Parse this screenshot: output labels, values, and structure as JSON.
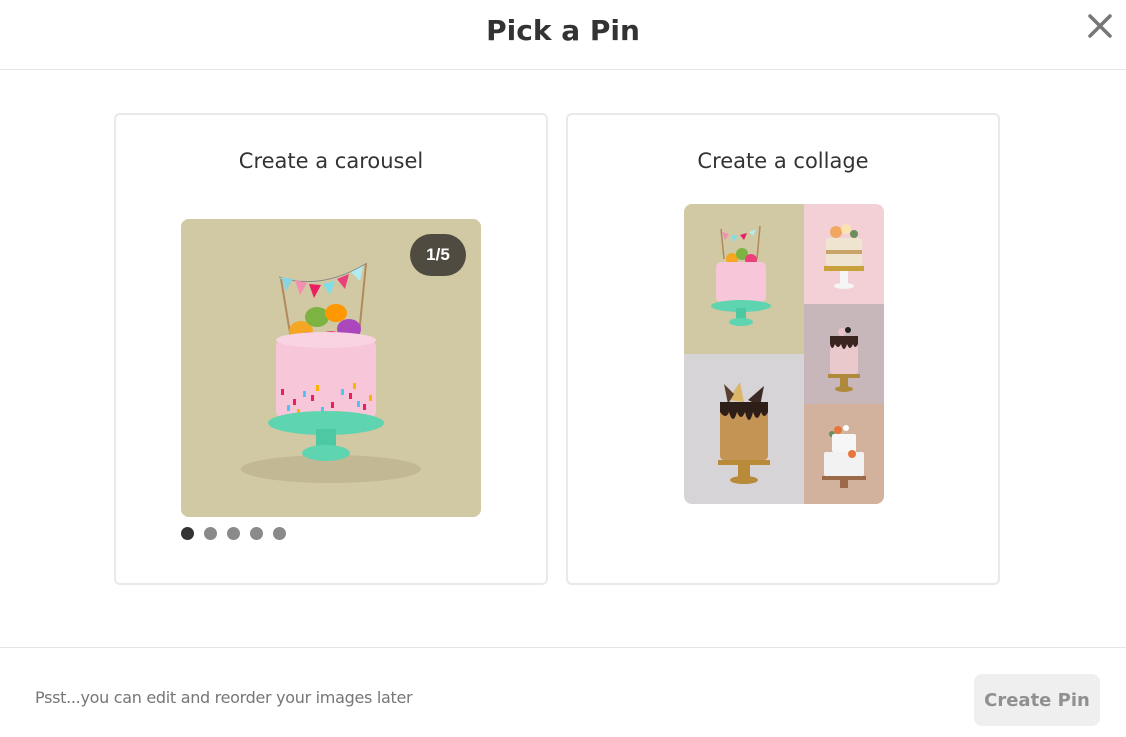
{
  "dialog": {
    "title": "Pick a Pin",
    "close_icon": "close-icon"
  },
  "options": {
    "carousel": {
      "title": "Create a carousel",
      "counter": "1/5",
      "active_slide": 1,
      "slide_count": 5
    },
    "collage": {
      "title": "Create a collage"
    }
  },
  "footer": {
    "hint": "Psst...you can edit and reorder your images later",
    "create_label": "Create Pin"
  },
  "colors": {
    "card_border": "#e9e9e9",
    "badge_bg": "#4f4b40",
    "dot_active": "#333333",
    "dot_inactive": "#8a8a8a",
    "button_disabled_bg": "#efefef",
    "button_disabled_text": "#909090"
  }
}
